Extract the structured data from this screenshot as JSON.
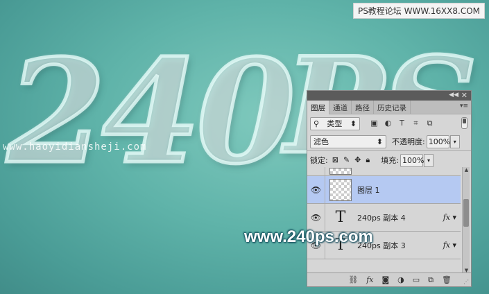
{
  "watermarks": {
    "top": "PS教程论坛 WWW.16XX8.COM",
    "middle": "www.haoyidiansheji.com",
    "bottom": "www.240ps.com"
  },
  "artwork": {
    "text_main": "240",
    "text_ps": "PS"
  },
  "panel": {
    "tabs": [
      "图层",
      "通道",
      "路径",
      "历史记录"
    ],
    "active_tab": "图层",
    "filter": {
      "label": "类型",
      "icons": [
        "image-filter",
        "adjust-filter",
        "text-filter",
        "shape-filter",
        "smart-filter"
      ]
    },
    "blend_mode": "滤色",
    "opacity_label": "不透明度:",
    "opacity_value": "100%",
    "lock_label": "锁定:",
    "fill_label": "填充:",
    "fill_value": "100%",
    "layers": [
      {
        "name": "图层 1",
        "type": "pixel",
        "selected": true,
        "fx": ""
      },
      {
        "name": "240ps 副本 4",
        "type": "text",
        "selected": false,
        "fx": "fx"
      },
      {
        "name": "240ps 副本 3",
        "type": "text",
        "selected": false,
        "fx": "fx"
      }
    ],
    "bottom_icons": [
      "link-icon",
      "fx-icon",
      "mask-icon",
      "adjustment-icon",
      "folder-icon",
      "new-layer-icon",
      "trash-icon"
    ]
  }
}
